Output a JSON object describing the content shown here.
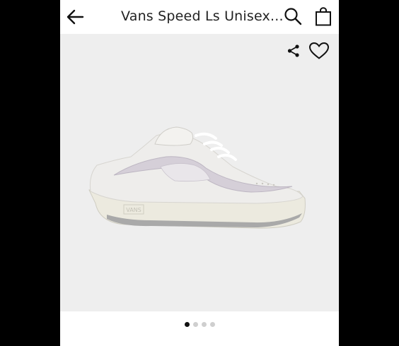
{
  "header": {
    "title": "Vans Speed Ls Unisex...",
    "back_icon": "arrow-left-icon",
    "search_icon": "search-icon",
    "bag_icon": "shopping-bag-icon"
  },
  "product_image": {
    "share_icon": "share-icon",
    "favorite_icon": "heart-icon",
    "brand_mark": "VANS",
    "background_color": "#eeeeee"
  },
  "carousel": {
    "total_pages": 4,
    "active_page": 1
  }
}
